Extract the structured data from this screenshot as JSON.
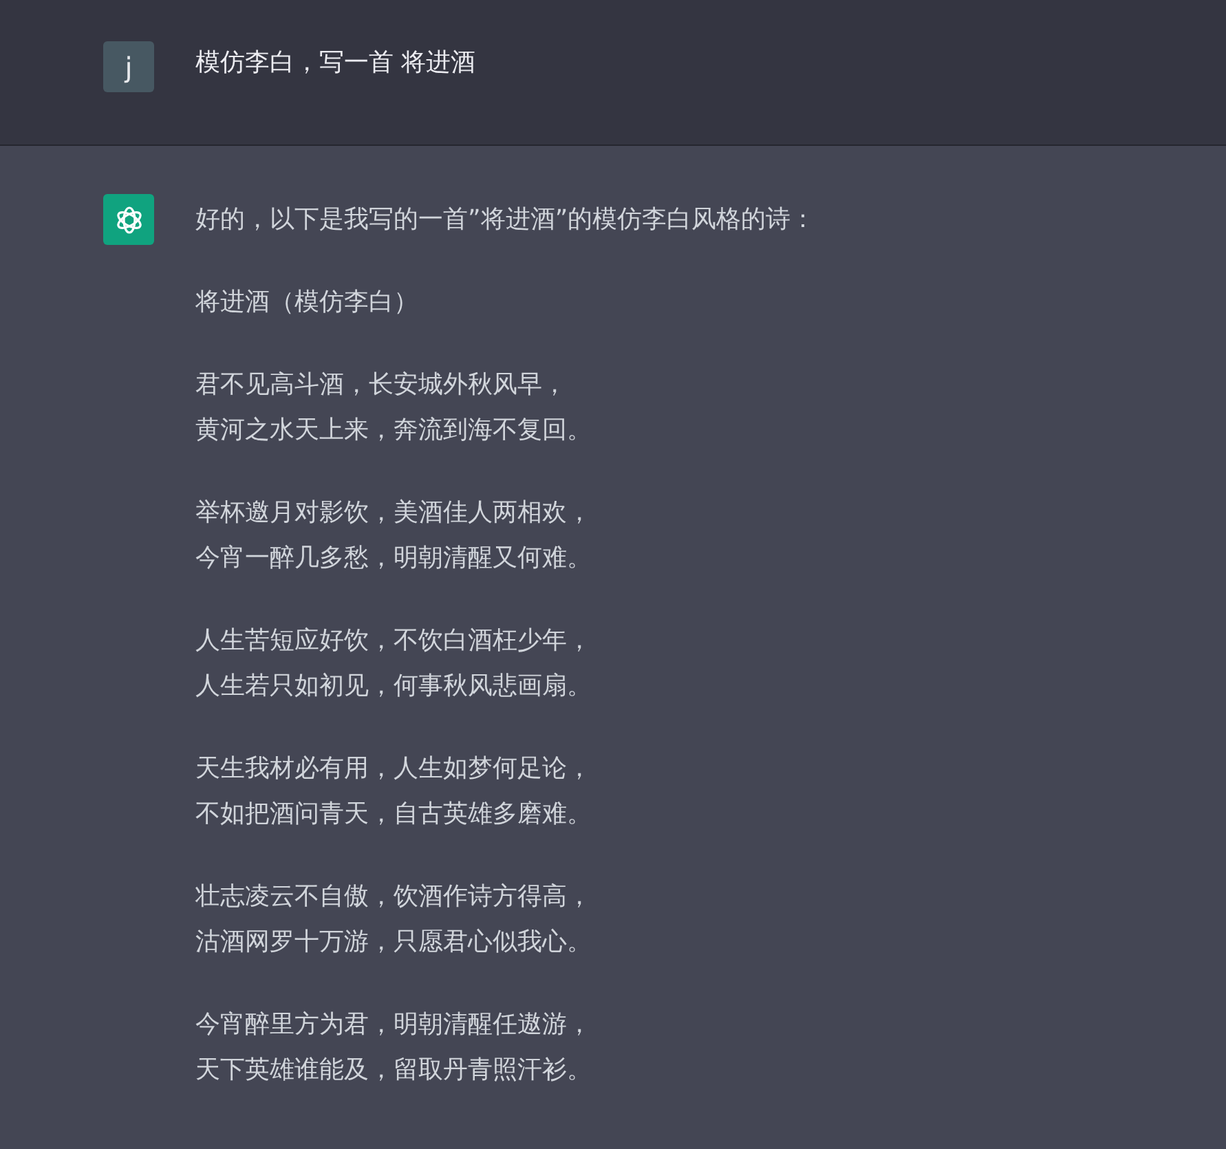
{
  "user_message": {
    "avatar_letter": "j",
    "text": "模仿李白，写一首 将进酒"
  },
  "assistant_message": {
    "intro": "好的，以下是我写的一首”将进酒”的模仿李白风格的诗：",
    "title": "将进酒（模仿李白）",
    "stanzas": [
      {
        "lines": [
          "君不见高斗酒，长安城外秋风早，",
          "黄河之水天上来，奔流到海不复回。"
        ]
      },
      {
        "lines": [
          "举杯邀月对影饮，美酒佳人两相欢，",
          "今宵一醉几多愁，明朝清醒又何难。"
        ]
      },
      {
        "lines": [
          "人生苦短应好饮，不饮白酒枉少年，",
          "人生若只如初见，何事秋风悲画扇。"
        ]
      },
      {
        "lines": [
          "天生我材必有用，人生如梦何足论，",
          "不如把酒问青天，自古英雄多磨难。"
        ]
      },
      {
        "lines": [
          "壮志凌云不自傲，饮酒作诗方得高，",
          "沽酒网罗十万游，只愿君心似我心。"
        ]
      },
      {
        "lines": [
          "今宵醉里方为君，明朝清醒任遨游，",
          "天下英雄谁能及，留取丹青照汗衫。"
        ]
      }
    ]
  }
}
